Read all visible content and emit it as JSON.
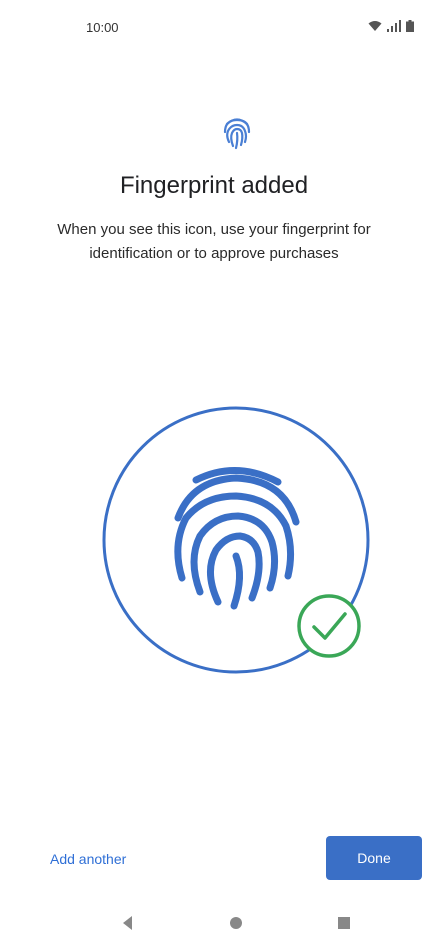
{
  "status_bar": {
    "time": "10:00",
    "icons": [
      "wifi-icon",
      "signal-icon",
      "battery-icon"
    ]
  },
  "header": {
    "icon": "fingerprint-icon",
    "title": "Fingerprint added",
    "subtitle": "When you see this icon, use your fingerprint for identification or to approve purchases"
  },
  "illustration": {
    "icon": "fingerprint-icon",
    "badge_icon": "check-circle-icon"
  },
  "actions": {
    "add_another_label": "Add another",
    "done_label": "Done"
  },
  "nav_bar": {
    "icons": [
      "back-icon",
      "home-icon",
      "recents-icon"
    ]
  },
  "colors": {
    "accent": "#3a6fc6",
    "link": "#2f6fd6",
    "success": "#3aa757"
  }
}
